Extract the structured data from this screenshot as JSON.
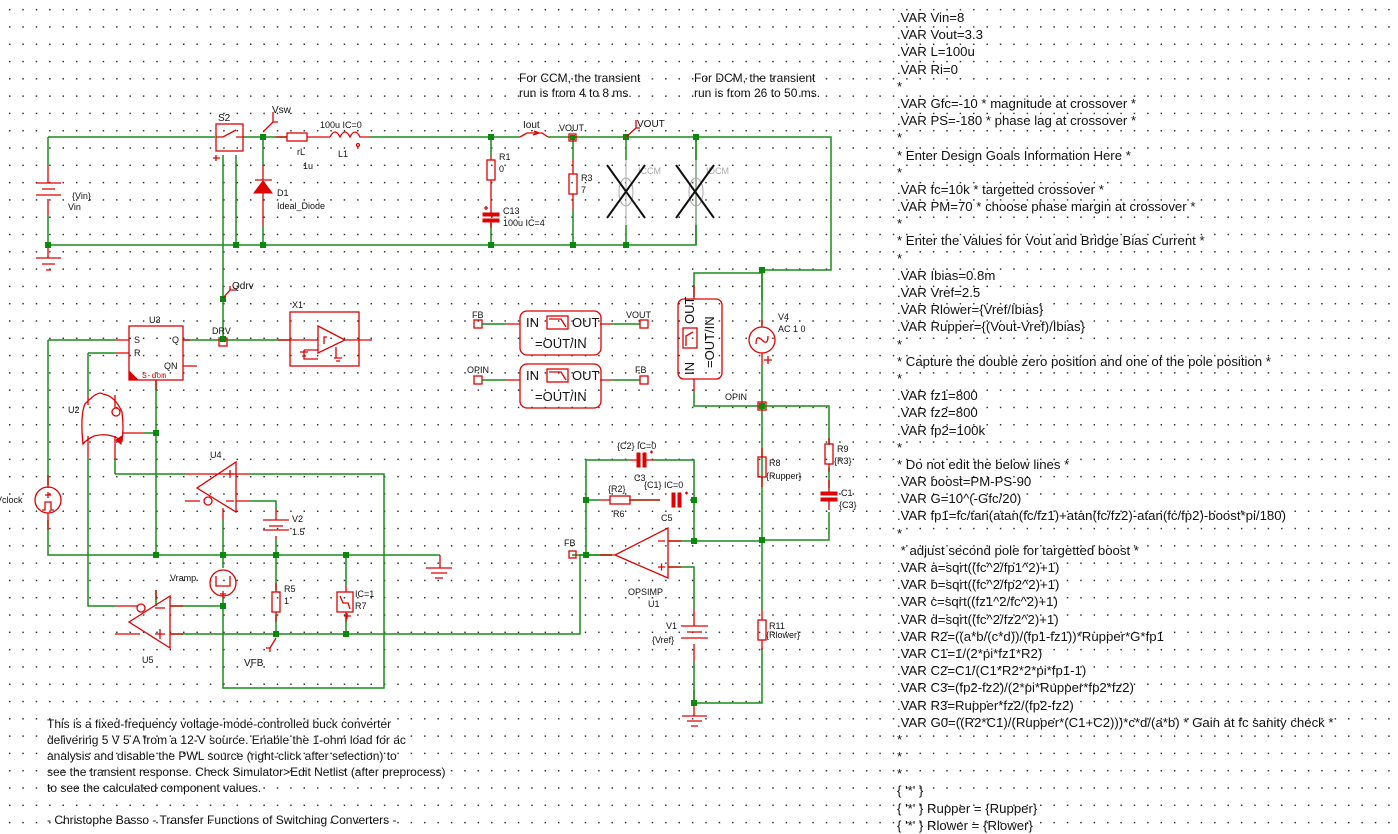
{
  "netlist_lines": [
    ".VAR Vin=8",
    ".VAR Vout=3.3",
    ".VAR L=100u",
    ".VAR Ri=0",
    "*",
    ".VAR Gfc=-10 * magnitude at crossover *",
    ".VAR PS=-180 * phase lag at crossover *",
    "*",
    "* Enter Design Goals Information Here *",
    "*",
    ".VAR fc=10k * targetted crossover *",
    ".VAR PM=70 * choose phase margin at crossover *",
    "*",
    "* Enter the Values for Vout and Bridge Bias Current *",
    "*",
    ".VAR Ibias=0.8m",
    ".VAR Vref=2.5",
    ".VAR Rlower={Vref/Ibias}",
    ".VAR Rupper={(Vout-Vref)/Ibias}",
    "*",
    "* Capture the double zero position and one of the pole position *",
    "*",
    ".VAR fz1=800",
    ".VAR fz2=800",
    ".VAR fp2=100k",
    "*",
    "* Do not edit the below lines *",
    ".VAR boost=PM-PS-90",
    ".VAR G=10^(-Gfc/20)",
    ".VAR fp1=fc/tan(atan(fc/fz1)+atan(fc/fz2)-atan(fc/fp2)-boost*pi/180)",
    "*",
    " * adjust second pole for targetted boost *",
    ".VAR a=sqrt((fc^2/fp1^2)+1)",
    ".VAR b=sqrt((fc^2/fp2^2)+1)",
    ".VAR c=sqrt((fz1^2/fc^2)+1)",
    ".VAR d=sqrt((fc^2/fz2^2)+1)",
    ".VAR R2=((a*b/(c*d))/(fp1-fz1))*Rupper*G*fp1",
    ".VAR C1=1/(2*pi*fz1*R2)",
    ".VAR C2=C1/(C1*R2*2*pi*fp1-1)",
    ".VAR C3=(fp2-fz2)/(2*pi*Rupper*fp2*fz2)",
    ".VAR R3=Rupper*fz2/(fp2-fz2)",
    ".VAR G0=((R2*C1)/(Rupper*(C1+C2)))*c*d/(a*b) * Gain at fc sanity check *",
    "*",
    "*",
    "*",
    "{ '*' }",
    "{ '*' } Rupper = {Rupper}",
    "{ '*' } Rlower = {Rlower}"
  ],
  "notes": {
    "ccm": "For CCM, the transient\nrun is from 4 to 8 ms.",
    "dcm": "For DCM, the transient\nrun is from 26 to 50 ms.",
    "description": "This is a fixed-frequency voltage-mode-controlled buck converter\ndelivering 5 V 5 A from a 12-V source. Enable the 1-ohm load for ac\nanalysis and disable the PWL source (right-click after selection) to\nsee the transient response. Check Simulator>Edit Netlist (after preprocess)\nto see the calculated component values.\n\n- Christophe Basso - Transfer Functions of Switching Converters -"
  },
  "components": {
    "vin": {
      "name": "Vin",
      "value": "{Vin}"
    },
    "s2": {
      "name": "S2"
    },
    "vsw": {
      "name": "Vsw"
    },
    "rl": {
      "name": "rL",
      "value": "1u"
    },
    "l1": {
      "name": "L1",
      "value": "100u IC=0"
    },
    "d1": {
      "name": "D1",
      "value": "Ideal_Diode"
    },
    "qdrv": {
      "name": "Qdrv"
    },
    "iout": {
      "name": "Iout"
    },
    "vout_probe": {
      "name": "VOUT"
    },
    "vout_net": {
      "name": "VOUT"
    },
    "r1": {
      "name": "R1",
      "value": "0"
    },
    "c13": {
      "name": "C13",
      "value": "100u IC=4"
    },
    "r3": {
      "name": "R3",
      "value": "7"
    },
    "iccm": {
      "name": "ICCM"
    },
    "idcm": {
      "name": "IDCM"
    },
    "u3": {
      "name": "U3",
      "pin_s": "S",
      "pin_r": "R",
      "pin_q": "Q",
      "pin_qn": "QN",
      "mark": "S-dom"
    },
    "drv": {
      "name": "DRV"
    },
    "x1": {
      "name": "X1"
    },
    "u2": {
      "name": "U2"
    },
    "u4": {
      "name": "U4"
    },
    "v2": {
      "name": "V2",
      "value": "1.5"
    },
    "vclock": {
      "name": "Vclock"
    },
    "vramp": {
      "name": "Vramp"
    },
    "r5": {
      "name": "R5",
      "value": "1"
    },
    "r7": {
      "name": "R7",
      "value": "IC=1"
    },
    "u5": {
      "name": "U5"
    },
    "vfb": {
      "name": "VFB"
    },
    "bode1": {
      "in": "IN",
      "out": "OUT",
      "formula": "=OUT/IN",
      "left": "FB",
      "right": "VOUT"
    },
    "bode2": {
      "in": "IN",
      "out": "OUT",
      "formula": "=OUT/IN",
      "left": "OPIN",
      "right": "FB"
    },
    "bode3": {
      "in": "IN",
      "out": "OUT",
      "formula": "=OUT/IN"
    },
    "v4": {
      "name": "V4",
      "value": "AC 1 0"
    },
    "opin": {
      "name": "OPIN"
    },
    "c3": {
      "name": "C3",
      "value": "{C2} IC=0"
    },
    "r6": {
      "name": "R6",
      "value": "{R2}"
    },
    "c5": {
      "name": "C5",
      "value": "{C1} IC=0"
    },
    "fb": {
      "name": "FB"
    },
    "u1": {
      "name": "U1",
      "value": "OPSIMP"
    },
    "v1": {
      "name": "V1",
      "value": "{Vref}"
    },
    "r8": {
      "name": "R8",
      "value": "{Rupper}"
    },
    "r9": {
      "name": "R9",
      "value": "{R3}"
    },
    "c1": {
      "name": "C1",
      "value": "{C3}"
    },
    "r11": {
      "name": "R11",
      "value": "{Rlower}"
    }
  },
  "colors": {
    "wire": "#1a8c1a",
    "component": "#e00000",
    "disabled": "#aaaaaa"
  }
}
